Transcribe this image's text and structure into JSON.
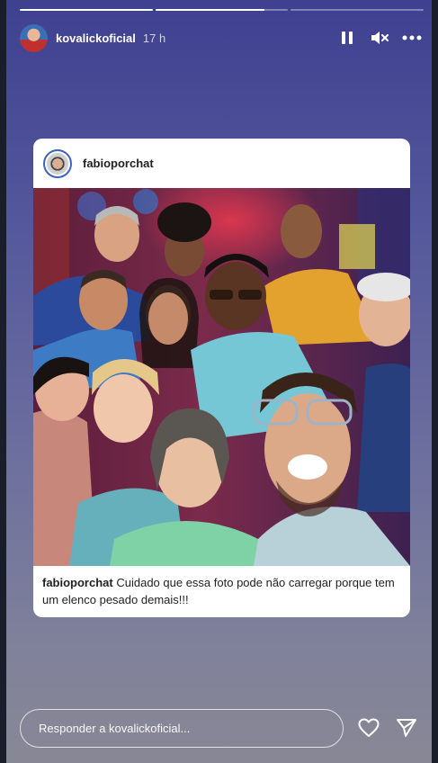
{
  "story": {
    "progress": [
      1.0,
      0.82,
      0.0
    ],
    "username": "kovalickoficial",
    "time_ago": "17 h",
    "icons": {
      "pause": "pause-icon",
      "mute": "mute-icon",
      "more": "more-icon"
    }
  },
  "post": {
    "author": "fabioporchat",
    "caption_user": "fabioporchat",
    "caption_text": "Cuidado que essa foto pode não carregar porque tem um elenco pesado demais!!!"
  },
  "reply": {
    "placeholder": "Responder a kovalickoficial...",
    "icons": {
      "like": "heart-icon",
      "send": "send-icon"
    }
  }
}
